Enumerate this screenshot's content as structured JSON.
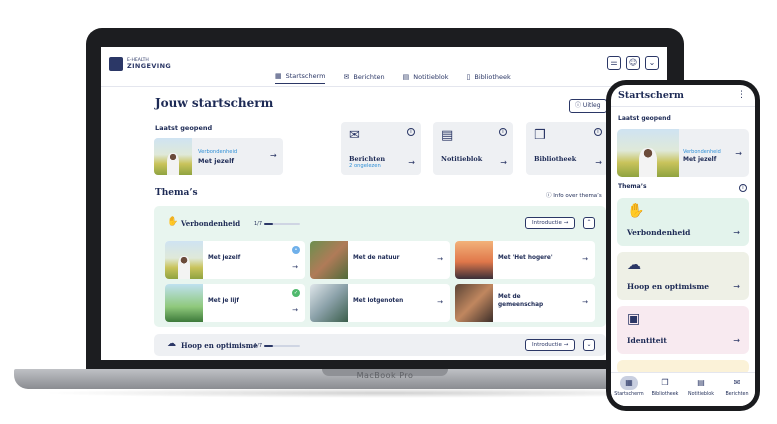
{
  "laptop": {
    "brand": "MacBook Pro",
    "logo": {
      "small": "E-HEALTH",
      "big": "ZINGEVING"
    },
    "top_icons": [
      "sliders-icon",
      "user-icon",
      "chevron-down-icon"
    ],
    "nav": [
      {
        "label": "Startscherm",
        "icon": "map-icon",
        "active": true
      },
      {
        "label": "Berichten",
        "icon": "mail-icon",
        "active": false
      },
      {
        "label": "Notitieblok",
        "icon": "notebook-icon",
        "active": false
      },
      {
        "label": "Bibliotheek",
        "icon": "book-icon",
        "active": false
      }
    ],
    "page_title": "Jouw startscherm",
    "uitleg_label": "Uitleg",
    "last_opened_label": "Laatst geopend",
    "recent": {
      "category": "Verbondenheid",
      "name": "Met jezelf"
    },
    "tiles": [
      {
        "label": "Berichten",
        "sub": "2 ongelezen",
        "icon": "mail-icon"
      },
      {
        "label": "Notitieblok",
        "sub": "",
        "icon": "notebook-icon"
      },
      {
        "label": "Bibliotheek",
        "sub": "",
        "icon": "book-icon"
      }
    ],
    "themes_title": "Thema’s",
    "themes_info_link": "Info over thema’s",
    "theme1": {
      "name": "Verbondenheid",
      "progress_label": "1/7",
      "progress": 0.14,
      "intro_label": "Introductie",
      "lessons": [
        {
          "name": "Met jezelf",
          "status": "in-progress"
        },
        {
          "name": "Met de natuur",
          "status": ""
        },
        {
          "name": "Met 'Het hogere'",
          "status": ""
        },
        {
          "name": "Met je lijf",
          "status": "done"
        },
        {
          "name": "Met lotgenoten",
          "status": ""
        },
        {
          "name": "Met de gemeenschap",
          "status": ""
        }
      ]
    },
    "theme2": {
      "name": "Hoop en optimisme",
      "progress_label": "1/7",
      "progress": 0.14,
      "intro_label": "Introductie"
    }
  },
  "phone": {
    "title": "Startscherm",
    "last_opened_label": "Laatst geopend",
    "recent": {
      "category": "Verbondenheid",
      "name": "Met jezelf"
    },
    "themes_label": "Thema’s",
    "cards": [
      {
        "label": "Verbondenheid",
        "color": "#e3f3ec",
        "icon": "hands-icon"
      },
      {
        "label": "Hoop en optimisme",
        "color": "#eef0e6",
        "icon": "cloud-smile-icon"
      },
      {
        "label": "Identiteit",
        "color": "#f8eaf0",
        "icon": "id-badge-icon"
      }
    ],
    "tabs": [
      {
        "label": "Startscherm",
        "icon": "map-icon",
        "active": true
      },
      {
        "label": "Bibliotheek",
        "icon": "book-icon",
        "active": false
      },
      {
        "label": "Notitieblok",
        "icon": "notebook-icon",
        "active": false
      },
      {
        "label": "Berichten",
        "icon": "mail-icon",
        "active": false
      }
    ]
  },
  "colors": {
    "navy": "#1d2a55",
    "accent_blue": "#2f8fd6",
    "theme_green": "#e8f5ef",
    "done_green": "#4fb96d"
  }
}
